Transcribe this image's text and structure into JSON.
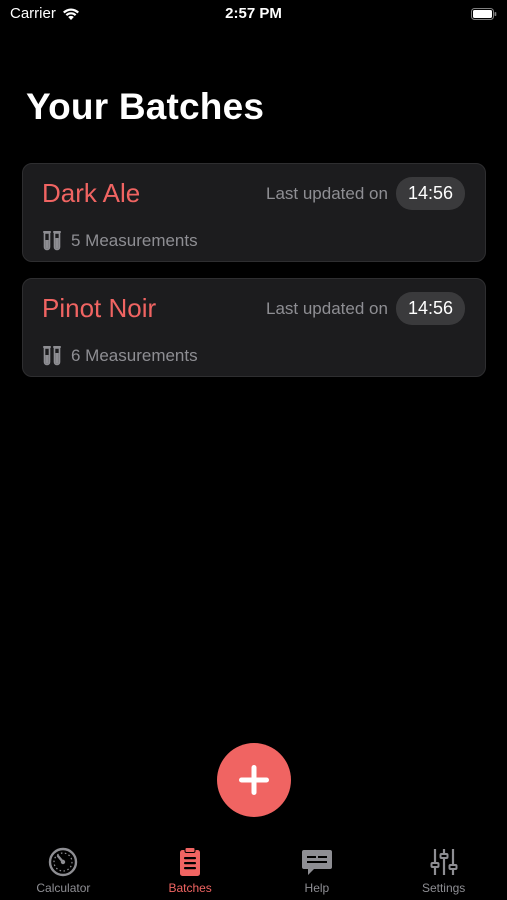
{
  "status_bar": {
    "carrier": "Carrier",
    "time": "2:57 PM"
  },
  "page": {
    "title": "Your Batches"
  },
  "batches": [
    {
      "name": "Dark Ale",
      "updated_label": "Last updated on",
      "updated_time": "14:56",
      "measurements": "5 Measurements"
    },
    {
      "name": "Pinot Noir",
      "updated_label": "Last updated on",
      "updated_time": "14:56",
      "measurements": "6 Measurements"
    }
  ],
  "tabs": [
    {
      "label": "Calculator",
      "icon": "gauge-icon",
      "active": false
    },
    {
      "label": "Batches",
      "icon": "clipboard-icon",
      "active": true
    },
    {
      "label": "Help",
      "icon": "chat-icon",
      "active": false
    },
    {
      "label": "Settings",
      "icon": "sliders-icon",
      "active": false
    }
  ],
  "colors": {
    "accent": "#f06462",
    "background": "#000000",
    "card": "#1c1c1e",
    "secondary_text": "#8e8e93",
    "pill": "#3a3a3c"
  }
}
